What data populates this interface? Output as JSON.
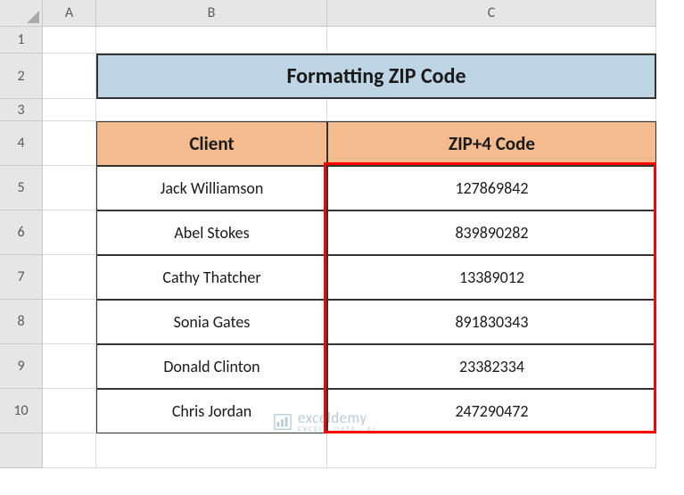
{
  "columns": [
    "A",
    "B",
    "C"
  ],
  "rows": [
    "1",
    "2",
    "3",
    "4",
    "5",
    "6",
    "7",
    "8",
    "9",
    "10"
  ],
  "title": "Formatting ZIP Code",
  "headers": {
    "client": "Client",
    "zip": "ZIP+4 Code"
  },
  "chart_data": {
    "type": "table",
    "title": "Formatting ZIP Code",
    "columns": [
      "Client",
      "ZIP+4 Code"
    ],
    "rows": [
      {
        "client": "Jack Williamson",
        "zip": "127869842"
      },
      {
        "client": "Abel Stokes",
        "zip": "839890282"
      },
      {
        "client": "Cathy Thatcher",
        "zip": "13389012"
      },
      {
        "client": "Sonia Gates",
        "zip": "891830343"
      },
      {
        "client": "Donald Clinton",
        "zip": "23382334"
      },
      {
        "client": "Chris Jordan",
        "zip": "247290472"
      }
    ]
  },
  "watermark": {
    "main": "exceldemy",
    "sub": "EXCEL · DATA · AI"
  }
}
